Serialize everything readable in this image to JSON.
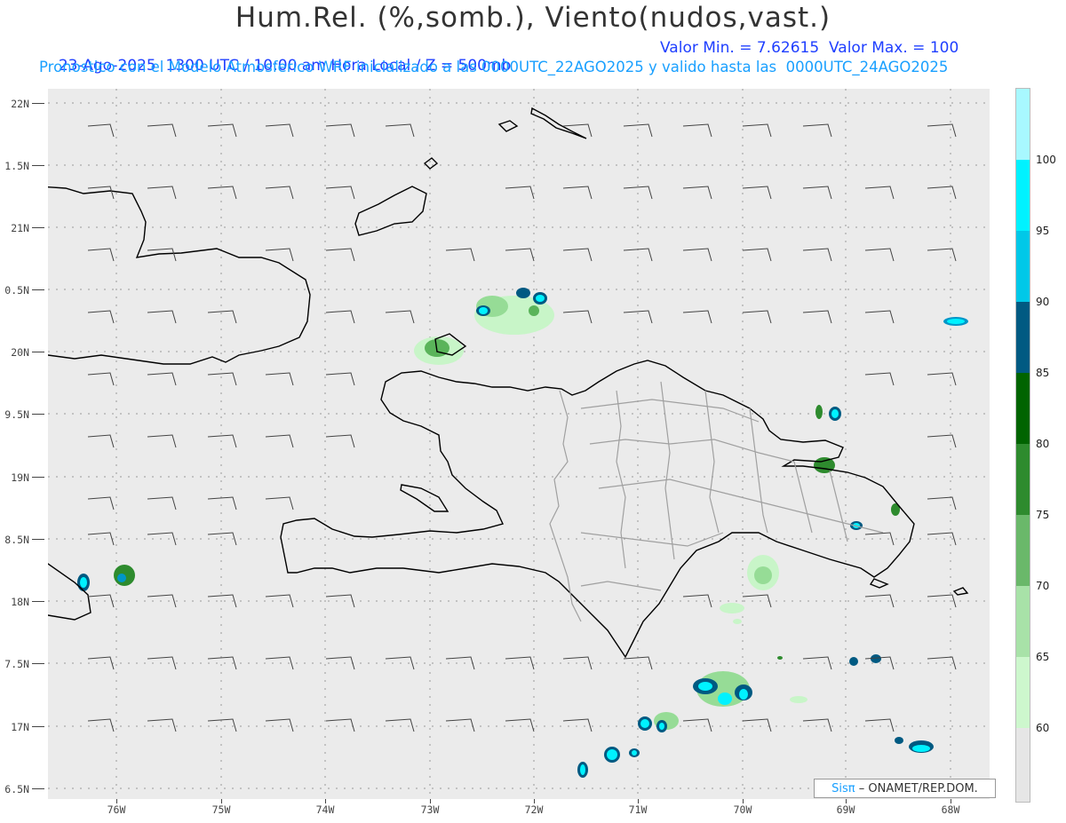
{
  "header": {
    "title": "Hum.Rel. (%,somb.), Viento(nudos,vast.)",
    "subtitle_left": "23-Ago-2025  1300 UTC / 10:00 am Hora Local / Z = 500mb",
    "subtitle_right": "Valor Min. = 7.62615  Valor Max. = 100",
    "subtitle2": "Pronostico con el Modelo Atmosferico WRF inicializado a las 0000UTC_22AGO2025 y valido hasta las  0000UTC_24AGO2025"
  },
  "map": {
    "background": "#ebebeb",
    "lat_labels": [
      "22N",
      "1.5N",
      "21N",
      "0.5N",
      "20N",
      "9.5N",
      "19N",
      "8.5N",
      "18N",
      "7.5N",
      "17N",
      "6.5N"
    ],
    "lon_labels": [
      "76W",
      "75W",
      "74W",
      "73W",
      "72W",
      "71W",
      "70W",
      "69W",
      "68W"
    ],
    "wind_barb_direction": "westerly-flow",
    "coast_color": "#000000",
    "province_color": "#a0a0a0"
  },
  "colorbar": {
    "labels": [
      "100",
      "95",
      "90",
      "85",
      "80",
      "75",
      "70",
      "65",
      "60"
    ],
    "colors": [
      "#a8f8ff",
      "#00f2ff",
      "#00c8e8",
      "#0096c8",
      "#005a82",
      "#006400",
      "#2e8b2e",
      "#5ab45a",
      "#96dc96",
      "#c8f5c8",
      "#e6e6e6"
    ]
  },
  "credit": {
    "brand": "Sisπ",
    "text": "– ONAMET/REP.DOM."
  }
}
